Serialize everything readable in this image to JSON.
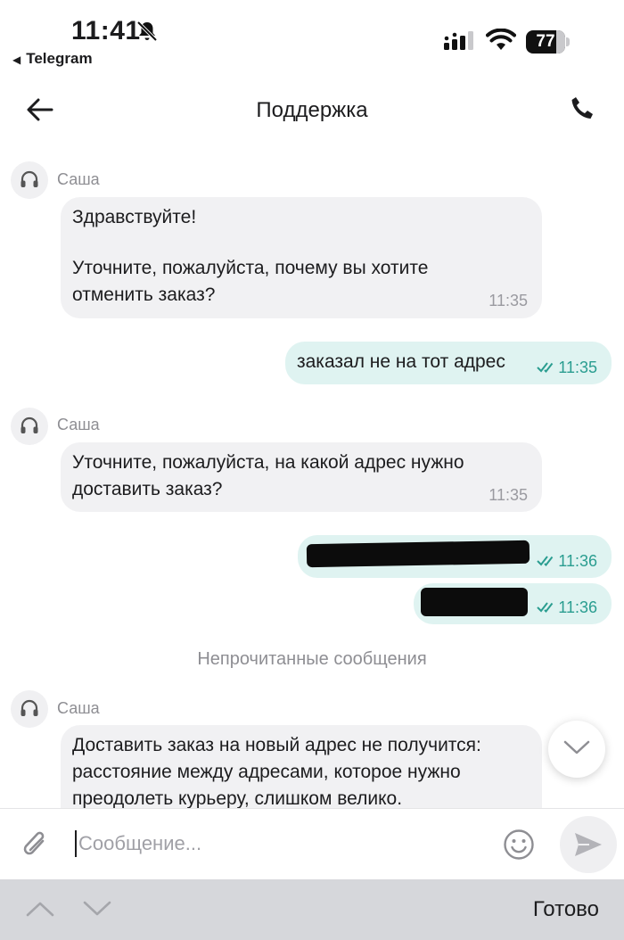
{
  "status_bar": {
    "time": "11:41",
    "back_app": "Telegram",
    "battery": "77"
  },
  "header": {
    "title": "Поддержка",
    "back_icon": "arrow-left-icon",
    "call_icon": "phone-icon"
  },
  "chat": {
    "messages": [
      {
        "direction": "in",
        "sender": "Саша",
        "lines": [
          "Здравствуйте!",
          "",
          "Уточните, пожалуйста, почему вы хотите",
          "отменить заказ?"
        ],
        "time": "11:35"
      },
      {
        "direction": "out",
        "text": "заказал не на тот адрес",
        "time": "11:35",
        "read": true
      },
      {
        "direction": "in",
        "sender": "Саша",
        "lines": [
          "Уточните, пожалуйста, на какой адрес нужно",
          "доставить заказ?"
        ],
        "time": "11:35"
      },
      {
        "direction": "out",
        "redacted": true,
        "time": "11:36",
        "read": true
      },
      {
        "direction": "out",
        "redacted": true,
        "time": "11:36",
        "read": true
      },
      {
        "direction": "in",
        "sender": "Саша",
        "lines": [
          "Доставить заказ на новый адрес не получится:",
          "расстояние между адресами, которое нужно",
          "преодолеть курьеру, слишком велико."
        ]
      }
    ],
    "unread_divider": "Непрочитанные сообщения"
  },
  "composer": {
    "placeholder": "Сообщение...",
    "value": ""
  },
  "keyboard_bar": {
    "done_label": "Готово"
  },
  "colors": {
    "incoming_bubble": "#f1f1f3",
    "outgoing_bubble": "#dff3f1",
    "read_check": "#2a9d90"
  }
}
